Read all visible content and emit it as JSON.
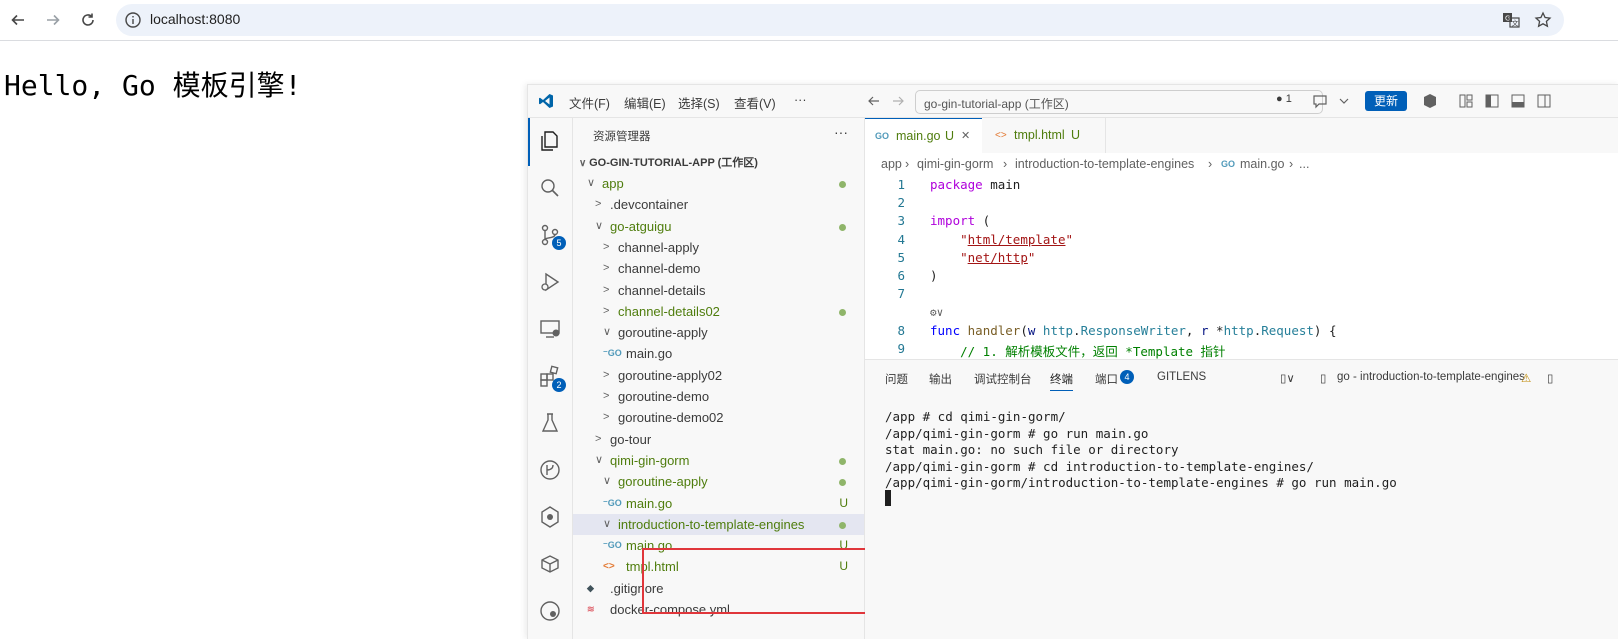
{
  "browser": {
    "url": "localhost:8080",
    "icons": [
      "back-icon",
      "forward-icon",
      "reload-icon",
      "info-icon",
      "translate-icon",
      "star-icon"
    ]
  },
  "page": {
    "hello": "Hello, Go 模板引擎!"
  },
  "vscode": {
    "menu": [
      "文件(F)",
      "编辑(E)",
      "选择(S)",
      "查看(V)",
      "···"
    ],
    "command_center": "go-gin-tutorial-app (工作区)",
    "notification_count": "● 1",
    "update_label": "更新",
    "activity_badges": {
      "source_control": "5",
      "extensions": "2"
    },
    "explorer": {
      "title": "资源管理器",
      "more": "···",
      "workspace": "GO-GIN-TUTORIAL-APP (工作区)",
      "items": [
        {
          "label": "app",
          "chev": "∨",
          "indent": 14,
          "color": "#4f7d0d",
          "dot": true
        },
        {
          "label": ".devcontainer",
          "chev": ">",
          "indent": 22,
          "color": "#3b3b3b"
        },
        {
          "label": "go-atguigu",
          "chev": "∨",
          "indent": 22,
          "color": "#4f7d0d",
          "dot": true
        },
        {
          "label": "channel-apply",
          "chev": ">",
          "indent": 30,
          "color": "#3b3b3b"
        },
        {
          "label": "channel-demo",
          "chev": ">",
          "indent": 30,
          "color": "#3b3b3b"
        },
        {
          "label": "channel-details",
          "chev": ">",
          "indent": 30,
          "color": "#3b3b3b"
        },
        {
          "label": "channel-details02",
          "chev": ">",
          "indent": 30,
          "color": "#4f7d0d",
          "dot": true
        },
        {
          "label": "goroutine-apply",
          "chev": "∨",
          "indent": 30,
          "color": "#3b3b3b"
        },
        {
          "label": "main.go",
          "go": true,
          "indent": 38,
          "color": "#3b3b3b"
        },
        {
          "label": "goroutine-apply02",
          "chev": ">",
          "indent": 30,
          "color": "#3b3b3b"
        },
        {
          "label": "goroutine-demo",
          "chev": ">",
          "indent": 30,
          "color": "#3b3b3b"
        },
        {
          "label": "goroutine-demo02",
          "chev": ">",
          "indent": 30,
          "color": "#3b3b3b"
        },
        {
          "label": "go-tour",
          "chev": ">",
          "indent": 22,
          "color": "#3b3b3b"
        },
        {
          "label": "qimi-gin-gorm",
          "chev": "∨",
          "indent": 22,
          "color": "#4f7d0d",
          "dot": true
        },
        {
          "label": "goroutine-apply",
          "chev": "∨",
          "indent": 30,
          "color": "#4f7d0d",
          "dot": true
        },
        {
          "label": "main.go",
          "go": true,
          "indent": 38,
          "color": "#4f7d0d",
          "marker": "U"
        },
        {
          "label": "introduction-to-template-engines",
          "chev": "∨",
          "indent": 30,
          "color": "#4f7d0d",
          "dot": true,
          "selected": true
        },
        {
          "label": "main.go",
          "go": true,
          "indent": 38,
          "color": "#4f7d0d",
          "marker": "U"
        },
        {
          "label": "tmpl.html",
          "html": true,
          "indent": 38,
          "color": "#4f7d0d",
          "marker": "U"
        },
        {
          "label": ".gitignore",
          "git": true,
          "indent": 22,
          "color": "#3b3b3b"
        },
        {
          "label": "docker-compose.yml",
          "docker": true,
          "indent": 22,
          "color": "#3b3b3b"
        }
      ]
    },
    "tabs": [
      {
        "icon": "GO",
        "label": "main.go",
        "marker": "U",
        "close": "✕"
      },
      {
        "icon": "<>",
        "label": "tmpl.html",
        "marker": "U"
      }
    ],
    "breadcrumb": [
      "app",
      "qimi-gin-gorm",
      "introduction-to-template-engines",
      "main.go",
      "..."
    ],
    "code_lines": [
      {
        "n": "1",
        "html": "<span class='kw'>package</span> main"
      },
      {
        "n": "2",
        "html": ""
      },
      {
        "n": "3",
        "html": "<span class='kw'>import</span> ("
      },
      {
        "n": "4",
        "html": "    <span class='str'>\"<u>html/template</u>\"</span>"
      },
      {
        "n": "5",
        "html": "    <span class='str'>\"<u>net/http</u>\"</span>"
      },
      {
        "n": "6",
        "html": ")"
      },
      {
        "n": "7",
        "html": ""
      },
      {
        "n": "",
        "html": "<span style='color:#616161;font-size:11px'>⚙∨</span>"
      },
      {
        "n": "8",
        "html": "<span class='kw2'>func</span> <span class='fn'>handler</span>(<span class='pm'>w</span> <span class='ty'>http</span>.<span class='ty'>ResponseWriter</span>, <span class='pm'>r</span> *<span class='ty'>http</span>.<span class='ty'>Request</span>) {"
      },
      {
        "n": "9",
        "html": "    <span class='cm'>// 1. 解析模板文件，返回 *Template 指针</span>"
      }
    ],
    "panel": {
      "tabs": [
        "问题",
        "输出",
        "调试控制台",
        "终端",
        "端口",
        "GITLENS"
      ],
      "ports_badge": "4",
      "terminal_name": "go - introduction-to-template-engines",
      "terminal_lines": [
        "/app # cd qimi-gin-gorm/",
        "/app/qimi-gin-gorm # go run main.go",
        "stat main.go: no such file or directory",
        "/app/qimi-gin-gorm # cd introduction-to-template-engines/",
        "/app/qimi-gin-gorm/introduction-to-template-engines # go run main.go"
      ]
    }
  }
}
